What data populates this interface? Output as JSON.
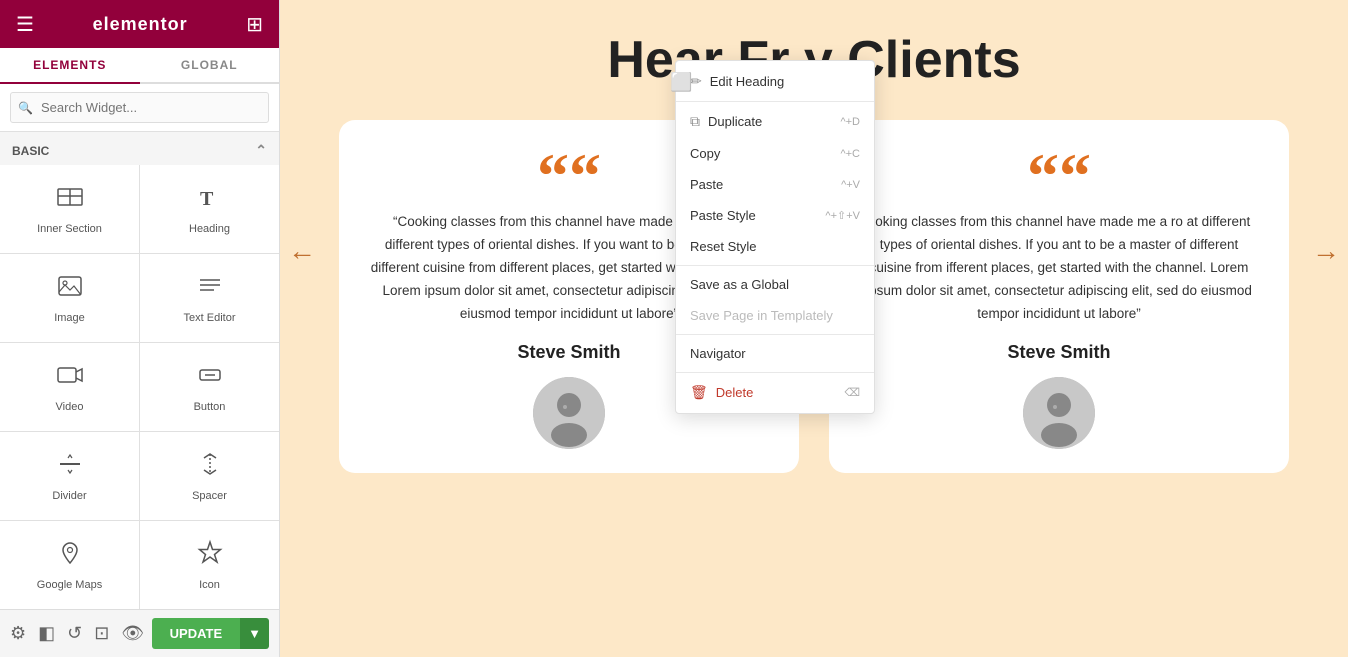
{
  "sidebar": {
    "header": {
      "title": "elementor",
      "menu_icon": "☰",
      "grid_icon": "⊞"
    },
    "tabs": [
      {
        "label": "ELEMENTS",
        "active": true
      },
      {
        "label": "GLOBAL",
        "active": false
      }
    ],
    "search": {
      "placeholder": "Search Widget..."
    },
    "section_label": "BASIC",
    "widgets": [
      {
        "id": "inner-section",
        "label": "Inner Section",
        "icon": "inner-section-icon"
      },
      {
        "id": "heading",
        "label": "Heading",
        "icon": "heading-icon"
      },
      {
        "id": "image",
        "label": "Image",
        "icon": "image-icon"
      },
      {
        "id": "text-editor",
        "label": "Text Editor",
        "icon": "text-editor-icon"
      },
      {
        "id": "video",
        "label": "Video",
        "icon": "video-icon"
      },
      {
        "id": "button",
        "label": "Button",
        "icon": "button-icon"
      },
      {
        "id": "divider",
        "label": "Divider",
        "icon": "divider-icon"
      },
      {
        "id": "spacer",
        "label": "Spacer",
        "icon": "spacer-icon"
      },
      {
        "id": "google-maps",
        "label": "Google Maps",
        "icon": "maps-icon"
      },
      {
        "id": "icon",
        "label": "Icon",
        "icon": "icon-icon"
      }
    ],
    "bottom": {
      "update_label": "UPDATE",
      "icons": [
        "settings-icon",
        "layers-icon",
        "history-icon",
        "template-icon",
        "eye-icon"
      ]
    }
  },
  "context_menu": {
    "items": [
      {
        "label": "Edit Heading",
        "shortcut": "",
        "type": "normal",
        "icon": "edit-icon"
      },
      {
        "label": "Duplicate",
        "shortcut": "^+D",
        "type": "normal",
        "icon": "duplicate-icon"
      },
      {
        "label": "Copy",
        "shortcut": "^+C",
        "type": "normal",
        "icon": ""
      },
      {
        "label": "Paste",
        "shortcut": "^+V",
        "type": "normal",
        "icon": ""
      },
      {
        "label": "Paste Style",
        "shortcut": "^+⇧+V",
        "type": "normal",
        "icon": ""
      },
      {
        "label": "Reset Style",
        "shortcut": "",
        "type": "normal",
        "icon": ""
      },
      {
        "label": "Save as a Global",
        "shortcut": "",
        "type": "normal",
        "icon": ""
      },
      {
        "label": "Save Page in Templately",
        "shortcut": "",
        "type": "disabled",
        "icon": ""
      },
      {
        "label": "Navigator",
        "shortcut": "",
        "type": "normal",
        "icon": ""
      },
      {
        "label": "Delete",
        "shortcut": "⌫",
        "type": "danger",
        "icon": "trash-icon"
      }
    ]
  },
  "main": {
    "title_part1": "Hear Fr",
    "title_part2": "y Clients",
    "testimonials": [
      {
        "quote_char": "““",
        "text": "“Cooking classes from this channel have made me a pro at different types of oriental dishes. If you want to be a master of different cuisine from different places, get started with the channel. Lorem ipsum dolor sit amet, consectetur adipiscing elit, sed do eiusmod tempor incididunt ut labore”",
        "name": "Steve Smith"
      },
      {
        "quote_char": "““",
        "text": "ooking classes from this channel have made me a ro at different types of oriental dishes. If you ant to be a master of different cuisine from ifferent places, get started with the channel. Lorem ipsum dolor sit amet, consectetur adipiscing elit, sed do eiusmod tempor incididunt ut labore”",
        "name": "Steve Smith"
      }
    ]
  },
  "colors": {
    "brand": "#92003b",
    "accent": "#e07020",
    "bg": "#fde8c8",
    "card_bg": "#ffffff",
    "update_green": "#4caf50"
  }
}
